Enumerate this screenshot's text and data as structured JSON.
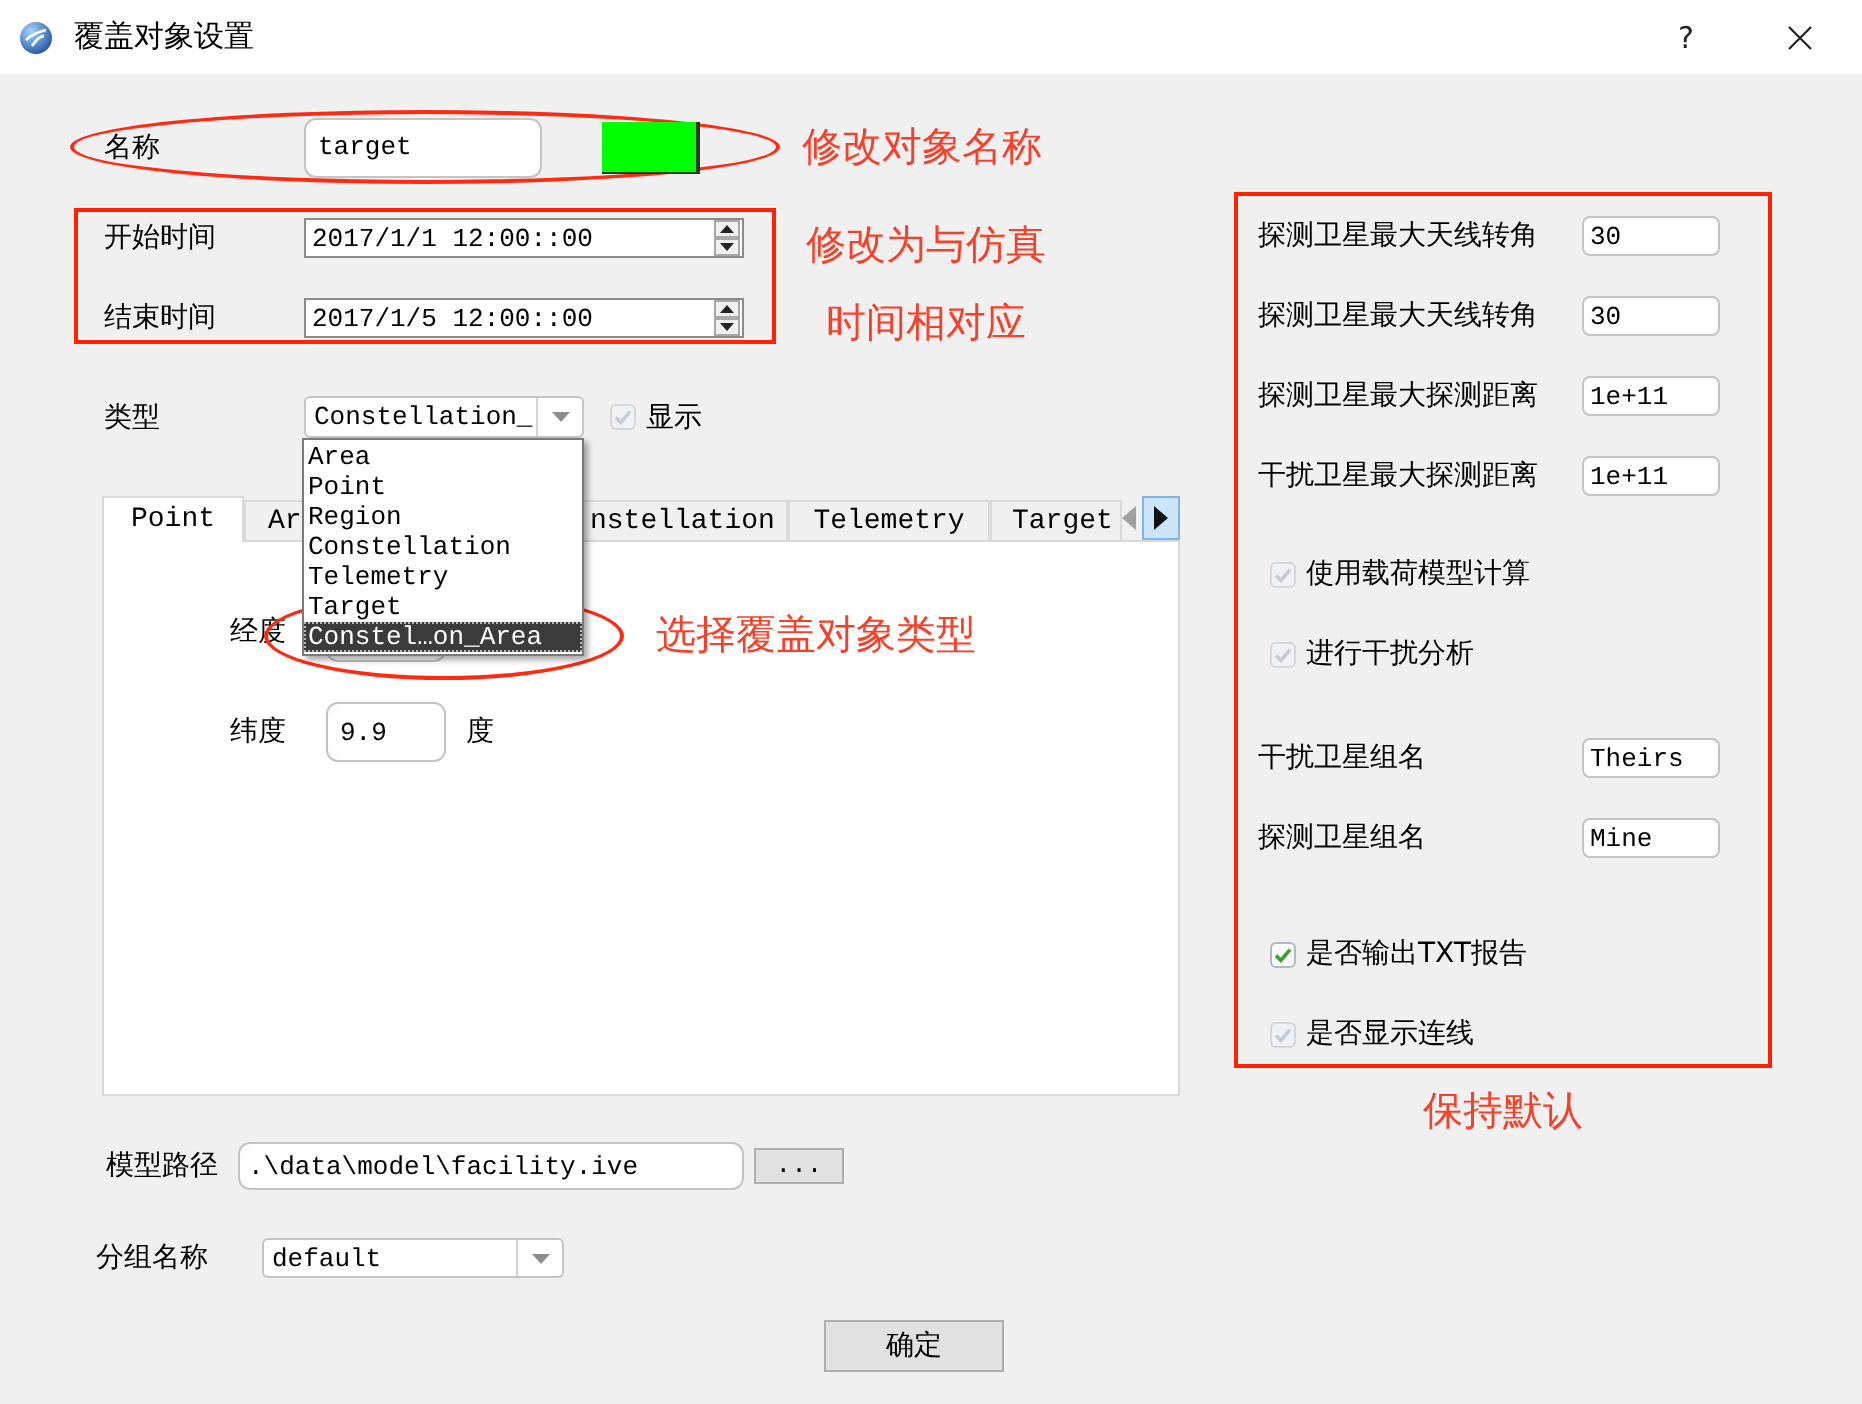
{
  "window": {
    "title": "覆盖对象设置",
    "help": "?"
  },
  "name_row": {
    "label": "名称",
    "value": "target",
    "color": "#00ff00",
    "annotation": "修改对象名称"
  },
  "time_rows": [
    {
      "label": "开始时间",
      "value": "2017/1/1 12:00::00"
    },
    {
      "label": "结束时间",
      "value": "2017/1/5 12:00::00"
    }
  ],
  "time_annotation": "修改为与仿真时间相对应",
  "type_row": {
    "label": "类型",
    "value": "Constellation_",
    "options": [
      {
        "label": "Area",
        "selected": false
      },
      {
        "label": "Point",
        "selected": false
      },
      {
        "label": "Region",
        "selected": false
      },
      {
        "label": "Constellation",
        "selected": false
      },
      {
        "label": "Telemetry",
        "selected": false
      },
      {
        "label": "Target",
        "selected": false
      },
      {
        "label": "Constel…on_Area",
        "selected": true
      }
    ],
    "show": {
      "label": "显示",
      "checked": true,
      "disabled": true
    },
    "annotation": "选择覆盖对象类型"
  },
  "tabs": [
    {
      "label": "Point",
      "selected": true
    },
    {
      "label": "Ar",
      "selected": false
    },
    {
      "label": "nstellation",
      "selected": false
    },
    {
      "label": "Telemetry",
      "selected": false
    },
    {
      "label": "Target",
      "selected": false
    }
  ],
  "point_fields": [
    {
      "label": "经度"
    },
    {
      "label": "纬度",
      "value": "9.9",
      "unit": "度"
    }
  ],
  "right_panel": {
    "groups": [
      {
        "items": [
          {
            "kind": "field",
            "label": "探测卫星最大天线转角",
            "value": "30"
          },
          {
            "kind": "field",
            "label": "探测卫星最大天线转角",
            "value": "30"
          },
          {
            "kind": "field",
            "label": "探测卫星最大探测距离",
            "value": "1e+11"
          },
          {
            "kind": "field",
            "label": "干扰卫星最大探测距离",
            "value": "1e+11"
          }
        ]
      },
      {
        "items": [
          {
            "kind": "checkbox",
            "label": "使用载荷模型计算",
            "checked": true,
            "disabled": true
          },
          {
            "kind": "checkbox",
            "label": "进行干扰分析",
            "checked": true,
            "disabled": true
          }
        ]
      },
      {
        "items": [
          {
            "kind": "field",
            "label": "干扰卫星组名",
            "value": "Theirs"
          },
          {
            "kind": "field",
            "label": "探测卫星组名",
            "value": "Mine"
          }
        ]
      },
      {
        "items": [
          {
            "kind": "checkbox",
            "label": "是否输出TXT报告",
            "checked": true,
            "disabled": false
          },
          {
            "kind": "checkbox",
            "label": "是否显示连线",
            "checked": true,
            "disabled": true
          }
        ]
      }
    ],
    "annotation": "保持默认"
  },
  "model_path": {
    "label": "模型路径",
    "value": ".\\data\\model\\facility.ive",
    "browse": "..."
  },
  "group_row": {
    "label": "分组名称",
    "value": "default"
  },
  "ok_button": "确定"
}
